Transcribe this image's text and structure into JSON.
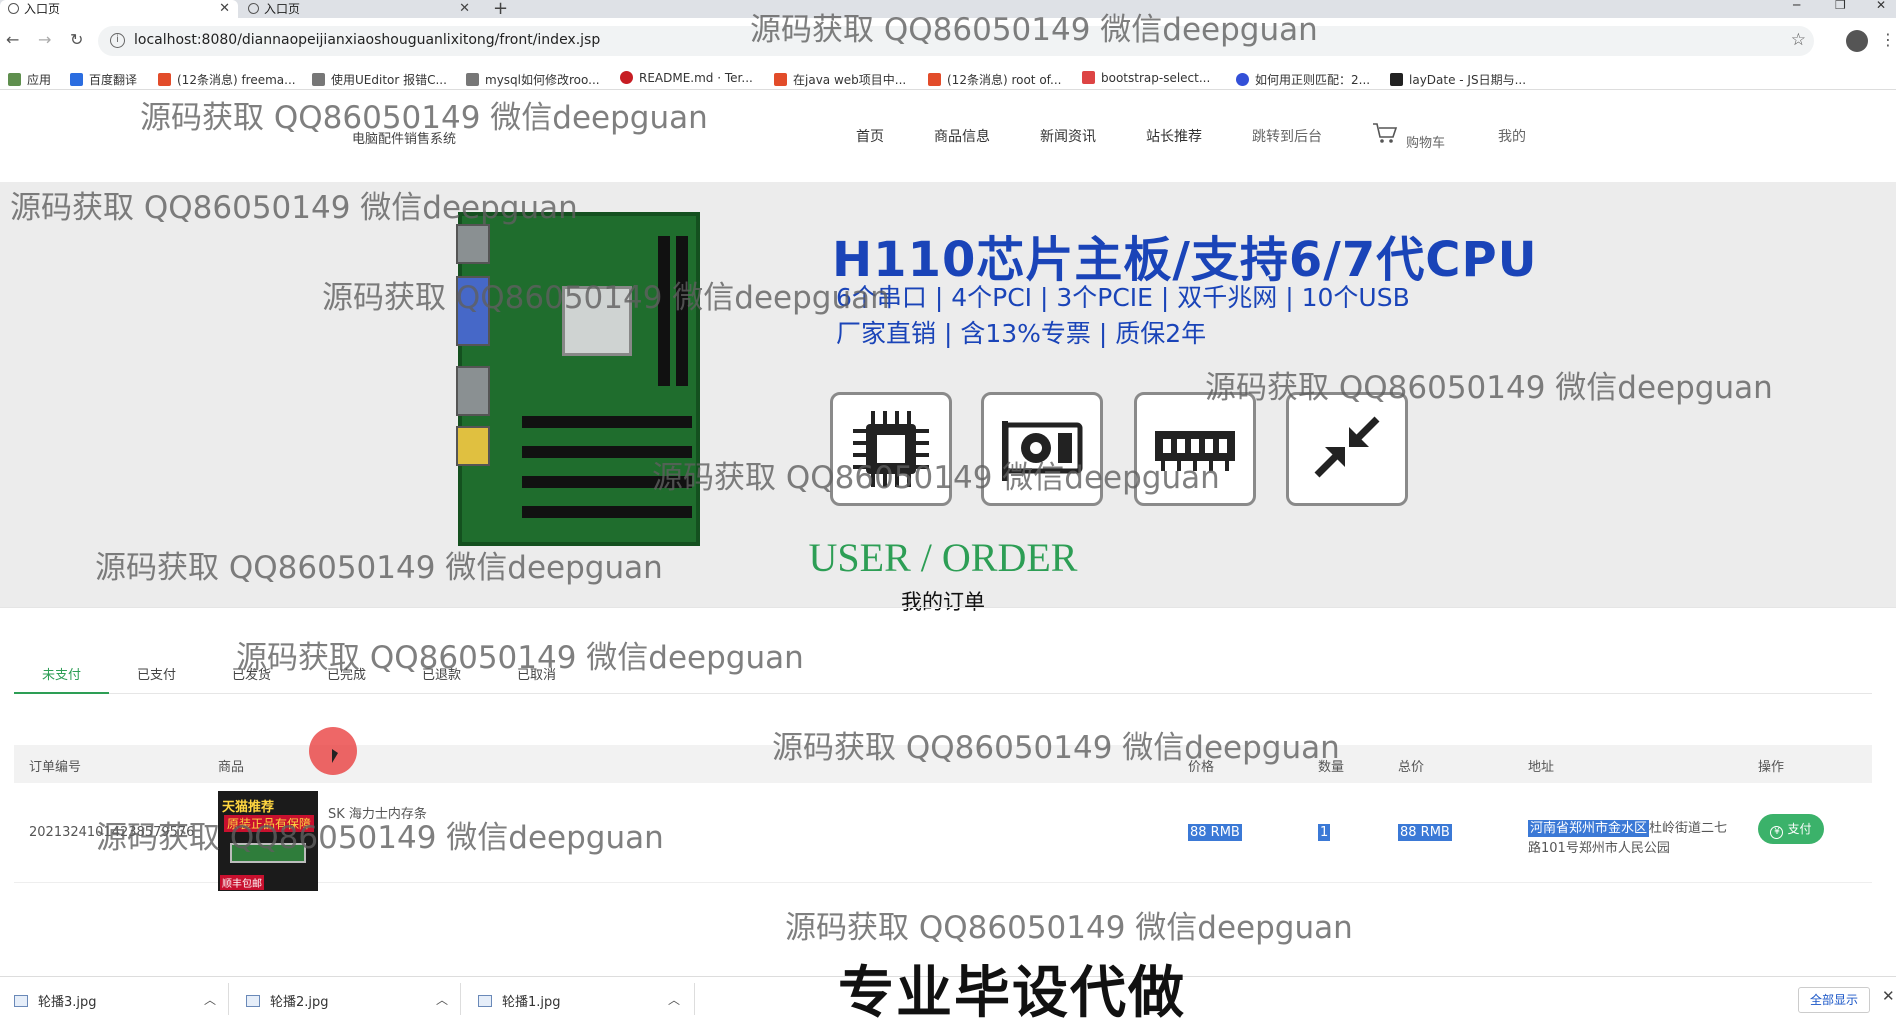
{
  "browser": {
    "tabs": [
      {
        "title": "入口页"
      },
      {
        "title": "入口页"
      }
    ],
    "url": "localhost:8080/diannaopeijianxiaoshouguanlixitong/front/index.jsp",
    "bookmarks": [
      "应用",
      "百度翻译",
      "(12条消息) freema...",
      "使用UEditor 报错C...",
      "mysql如何修改roo...",
      "README.md · Ter...",
      "在java web项目中...",
      "(12条消息) root of...",
      "bootstrap-select...",
      "如何用正则匹配：2...",
      "layDate - JS日期与..."
    ]
  },
  "site": {
    "logo": "电脑配件销售系统",
    "nav": [
      "首页",
      "商品信息",
      "新闻资讯",
      "站长推荐",
      "跳转到后台",
      "购物车",
      "我的"
    ]
  },
  "banner": {
    "headline": "H110芯片主板/支持6/7代CPU",
    "line1": "6个串口 | 4个PCI | 3个PCIE | 双千兆网 | 10个USB",
    "line2": "厂家直销 | 含13%专票 | 质保2年"
  },
  "section": {
    "title": "USER / ORDER",
    "subtitle": "我的订单"
  },
  "order_tabs": [
    "未支付",
    "已支付",
    "已发货",
    "已完成",
    "已退款",
    "已取消"
  ],
  "table": {
    "headers": [
      "订单编号",
      "商品",
      "价格",
      "数量",
      "总价",
      "地址",
      "操作"
    ],
    "rows": [
      {
        "order_no": "20213241014238579576",
        "product_img_text1": "天猫推荐",
        "product_img_text2": "原装正品有保障",
        "product_img_text3": "顺丰包邮",
        "product": "SK 海力士内存条",
        "price": "88 RMB",
        "qty": "1",
        "total": "88 RMB",
        "addr_selected": "河南省郑州市金水区",
        "addr_rest": "杜岭街道二七路101号郑州市人民公园",
        "action": "支付"
      }
    ]
  },
  "downloads": [
    "轮播3.jpg",
    "轮播2.jpg",
    "轮播1.jpg"
  ],
  "downloads_show_all": "全部显示",
  "watermark": "源码获取 QQ86050149 微信deepguan",
  "bottom_watermark": "专业毕设代做"
}
